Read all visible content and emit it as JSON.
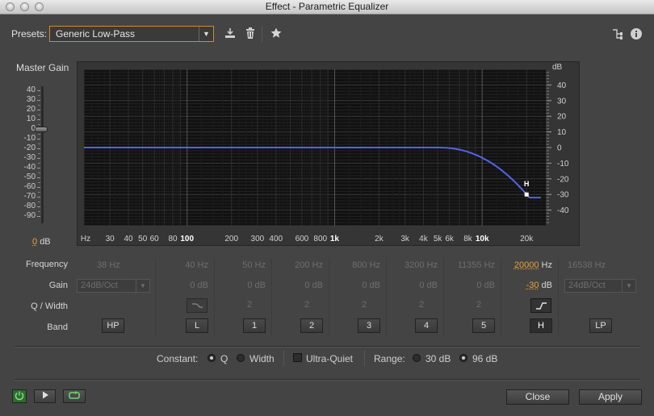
{
  "window": {
    "title": "Effect - Parametric Equalizer"
  },
  "toolbar": {
    "presets_label": "Presets:",
    "preset_value": "Generic Low-Pass",
    "icons": [
      "download-icon",
      "trash-icon",
      "star-icon",
      "routing-icon",
      "info-icon"
    ]
  },
  "master_gain": {
    "label": "Master Gain",
    "ticks": [
      "40",
      "30",
      "20",
      "10",
      "0",
      "-10",
      "-20",
      "-30",
      "-40",
      "-50",
      "-60",
      "-70",
      "-80",
      "-90"
    ],
    "value": "0",
    "unit": "dB",
    "slider_db": 0
  },
  "graph": {
    "db_axis_label": "dB",
    "db_ticks": [
      "40",
      "30",
      "20",
      "10",
      "0",
      "-10",
      "-20",
      "-30",
      "-40"
    ],
    "freq_ticks": [
      "Hz",
      "30",
      "40",
      "50",
      "60",
      "80",
      "100",
      "200",
      "300",
      "400",
      "600",
      "800",
      "1k",
      "2k",
      "3k",
      "4k",
      "5k",
      "6k",
      "8k",
      "10k",
      "20k"
    ],
    "freq_major": [
      "100",
      "1k",
      "10k"
    ],
    "h_marker_label": "H",
    "curve_color": "#5562e6"
  },
  "bands": {
    "row_labels": {
      "frequency": "Frequency",
      "gain": "Gain",
      "q": "Q / Width",
      "band": "Band"
    },
    "hp": {
      "freq": "38",
      "unit": "Hz",
      "slope": "24dB/Oct",
      "label": "HP"
    },
    "peaks": [
      {
        "label": "L",
        "freq": "40",
        "unit": "Hz",
        "gain": "0",
        "gain_unit": "dB"
      },
      {
        "label": "1",
        "freq": "50",
        "unit": "Hz",
        "gain": "0",
        "gain_unit": "dB",
        "q": "2"
      },
      {
        "label": "2",
        "freq": "200",
        "unit": "Hz",
        "gain": "0",
        "gain_unit": "dB",
        "q": "2"
      },
      {
        "label": "3",
        "freq": "800",
        "unit": "Hz",
        "gain": "0",
        "gain_unit": "dB",
        "q": "2"
      },
      {
        "label": "4",
        "freq": "3200",
        "unit": "Hz",
        "gain": "0",
        "gain_unit": "dB",
        "q": "2"
      },
      {
        "label": "5",
        "freq": "11355",
        "unit": "Hz",
        "gain": "0",
        "gain_unit": "dB",
        "q": "2"
      },
      {
        "label": "H",
        "freq": "20000",
        "unit": "Hz",
        "gain": "-30",
        "gain_unit": "dB"
      }
    ],
    "lp": {
      "freq": "16538",
      "unit": "Hz",
      "slope": "24dB/Oct",
      "label": "LP"
    }
  },
  "options": {
    "constant_label": "Constant:",
    "q_label": "Q",
    "width_label": "Width",
    "ultra_quiet_label": "Ultra-Quiet",
    "range_label": "Range:",
    "range_30": "30 dB",
    "range_96": "96 dB"
  },
  "footer": {
    "close_label": "Close",
    "apply_label": "Apply",
    "power_color": "#3fae3f"
  }
}
